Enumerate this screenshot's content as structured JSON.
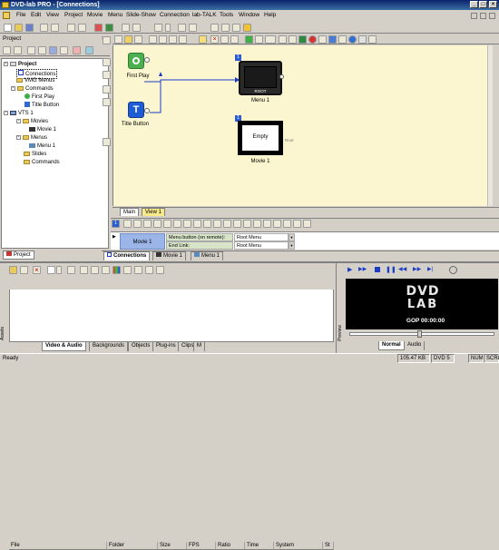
{
  "window": {
    "title": "DVD-lab PRO - [Connections]"
  },
  "menu": [
    "File",
    "Edit",
    "View",
    "Project",
    "Movie",
    "Menu",
    "Slide-Show",
    "Connection",
    "lab-TALK",
    "Tools",
    "Window",
    "Help"
  ],
  "project_panel": {
    "title": "Project",
    "tree": {
      "root": "Project",
      "connections": "Connections",
      "vmg_menus": "VMG Menus",
      "commands": "Commands",
      "first_play": "First Play",
      "title_button": "Title Button",
      "vts": "VTS 1",
      "movies": "Movies",
      "movie1": "Movie 1",
      "menus": "Menus",
      "menu1": "Menu 1",
      "slides": "Slides",
      "commands2": "Commands"
    },
    "tab": "Project"
  },
  "canvas": {
    "first_play": "First Play",
    "title_button": "Title Button",
    "menu_node": {
      "badge": "1",
      "inner": "ROOT",
      "label": "Menu 1"
    },
    "movie_node": {
      "badge": "1",
      "inner": "Empty",
      "label": "Movie 1",
      "aux": "Root"
    },
    "tabs": {
      "main": "Main",
      "view1": "View 1"
    }
  },
  "connections_table": {
    "movie": "Movie 1",
    "rows": [
      {
        "label": "Menu button (on remote):",
        "value": "Root Menu"
      },
      {
        "label": "End Link:",
        "value": "Root Menu"
      }
    ]
  },
  "doc_tabs": [
    "Connections",
    "Movie 1",
    "Menu 1"
  ],
  "assets": {
    "side_label": "Assets",
    "columns": [
      "File",
      "Folder",
      "Size",
      "FPS",
      "Ratio",
      "Time",
      "System",
      "St"
    ],
    "tabs": [
      "Video & Audio",
      "Backgrounds",
      "Objects",
      "Plug-ins",
      "Clips",
      "M"
    ]
  },
  "preview": {
    "side_label": "Preview",
    "logo_top": "DVD",
    "logo_bottom": "LAB",
    "gop": "GOP 00:00:00",
    "tabs": [
      "Normal",
      "Audio"
    ]
  },
  "status": {
    "ready": "Ready",
    "size": "105.47 KB",
    "disc": "DVD 5",
    "num": "NUM",
    "scrl": "SCRL"
  },
  "colors": {
    "titlebar": "#0a246a",
    "canvas": "#fbf6cf",
    "connector": "#1a3cc8"
  }
}
